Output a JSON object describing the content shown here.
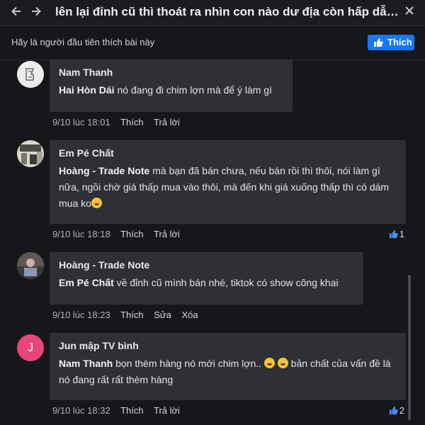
{
  "header": {
    "title": "lên lại đỉnh cũ thì thoát ra nhìn con nào dư địa còn hấp dẫn ...",
    "back_icon": "arrow-left-icon",
    "forward_icon": "arrow-right-icon",
    "close_icon": "close-icon"
  },
  "like_bar": {
    "prompt": "Hãy là người đầu tiên thích bài này",
    "like_label": "Thích",
    "accent": "#1877f2"
  },
  "comments": [
    {
      "author": "Nam Thanh",
      "mention": "Hai Hòn Dái",
      "text": " nó đang đi chim lợn mà để ý làm gì",
      "time": "9/10 lúc 18:01",
      "actions": [
        "Thích",
        "Trả lời"
      ],
      "reactions": ""
    },
    {
      "author": "Em Pé Chất",
      "mention": "Hoàng - Trade Note",
      "text": " mà bạn đã bán chưa, nếu bán rồi thì thôi, nói làm gì nữa, ngồi chờ giá thấp mua vào thôi, mà đến khi giá xuống thấp thì có dám mua ko",
      "time": "9/10 lúc 18:18",
      "actions": [
        "Thích",
        "Trả lời"
      ],
      "reactions": "1"
    },
    {
      "author": "Hoàng - Trade Note",
      "mention": "Em Pé Chất",
      "text": " về đỉnh cũ mình bán nhé, tiktok có show công khai",
      "time": "9/10 lúc 18:23",
      "actions": [
        "Thích",
        "Sửa",
        "Xóa"
      ],
      "reactions": ""
    },
    {
      "author": "Jun mập TV bình",
      "avatar_letter": "J",
      "mention": "Nam Thanh",
      "text_a": " bọn thèm hàng nó mới chim lợn.. ",
      "text_b": " bản chất của vấn đề là nó đang rất rất thèm hàng",
      "time": "9/10 lúc 18:32",
      "actions": [
        "Thích",
        "Trả lời"
      ],
      "reactions": "2"
    }
  ]
}
